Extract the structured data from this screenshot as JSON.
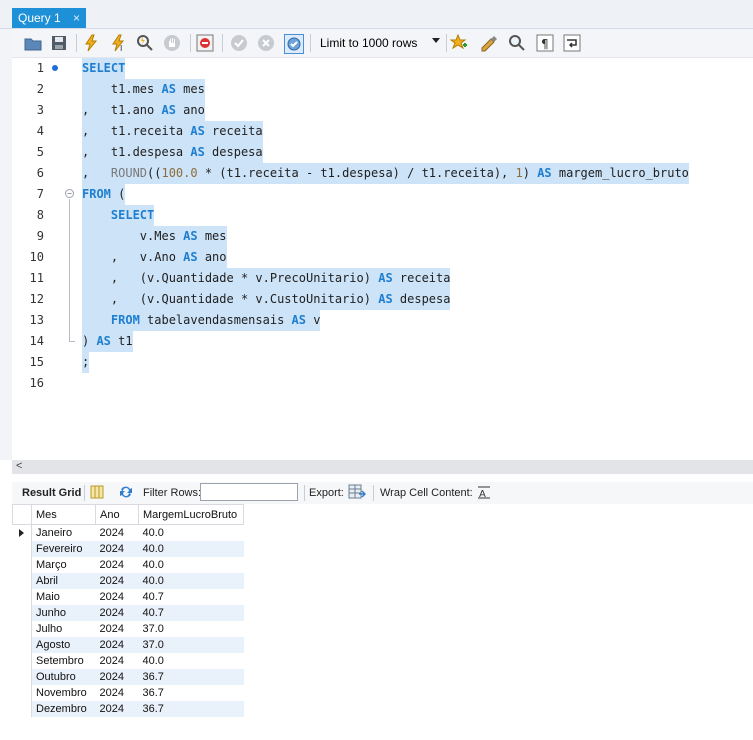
{
  "tab": {
    "title": "Query 1",
    "close": "×"
  },
  "toolbar": {
    "limit_label": "Limit to 1000 rows",
    "icons": [
      "open-file-icon",
      "save-icon",
      "execute-icon",
      "execute-current-icon",
      "explain-icon",
      "stop-icon",
      "toggle-error-icon",
      "commit-icon",
      "rollback-icon",
      "autocommit-icon",
      "limit-select",
      "add-snippet-icon",
      "beautify-icon",
      "find-icon",
      "invisible-chars-icon",
      "wrap-icon"
    ]
  },
  "editor": {
    "lines": [
      {
        "n": "1"
      },
      {
        "n": "2"
      },
      {
        "n": "3"
      },
      {
        "n": "4"
      },
      {
        "n": "5"
      },
      {
        "n": "6"
      },
      {
        "n": "7"
      },
      {
        "n": "8"
      },
      {
        "n": "9"
      },
      {
        "n": "10"
      },
      {
        "n": "11"
      },
      {
        "n": "12"
      },
      {
        "n": "13"
      },
      {
        "n": "14"
      },
      {
        "n": "15"
      },
      {
        "n": "16"
      }
    ],
    "code": {
      "l1_kw": "SELECT",
      "l2_a": "    t1.mes ",
      "l2_kw": "AS",
      "l2_b": " mes",
      "l3_a": ",   t1.ano ",
      "l3_kw": "AS",
      "l3_b": " ano",
      "l4_a": ",   t1.receita ",
      "l4_kw": "AS",
      "l4_b": " receita",
      "l5_a": ",   t1.despesa ",
      "l5_kw": "AS",
      "l5_b": " despesa",
      "l6_a": ",   ",
      "l6_fn": "ROUND",
      "l6_b": "((",
      "l6_n1": "100.0",
      "l6_c": " * (t1.receita - t1.despesa) / t1.receita), ",
      "l6_n2": "1",
      "l6_d": ") ",
      "l6_kw": "AS",
      "l6_e": " margem_lucro_bruto",
      "l7_kw": "FROM",
      "l7_a": " (",
      "l8_a": "    ",
      "l8_kw": "SELECT",
      "l9_a": "        v.Mes ",
      "l9_kw": "AS",
      "l9_b": " mes",
      "l10_a": "    ,   v.Ano ",
      "l10_kw": "AS",
      "l10_b": " ano",
      "l11_a": "    ,   (v.Quantidade * v.PrecoUnitario) ",
      "l11_kw": "AS",
      "l11_b": " receita",
      "l12_a": "    ,   (v.Quantidade * v.CustoUnitario) ",
      "l12_kw": "AS",
      "l12_b": " despesa",
      "l13_a": "    ",
      "l13_kw": "FROM",
      "l13_b": " tabelavendasmensais ",
      "l13_kw2": "AS",
      "l13_c": " v",
      "l14_a": ") ",
      "l14_kw": "AS",
      "l14_b": " t1",
      "l15_a": ";"
    }
  },
  "results_toolbar": {
    "result_grid": "Result Grid",
    "filter_rows": "Filter Rows:",
    "export": "Export:",
    "wrap_cell": "Wrap Cell Content:"
  },
  "grid": {
    "columns": [
      "Mes",
      "Ano",
      "MargemLucroBruto"
    ],
    "rows": [
      [
        "Janeiro",
        "2024",
        "40.0"
      ],
      [
        "Fevereiro",
        "2024",
        "40.0"
      ],
      [
        "Março",
        "2024",
        "40.0"
      ],
      [
        "Abril",
        "2024",
        "40.0"
      ],
      [
        "Maio",
        "2024",
        "40.7"
      ],
      [
        "Junho",
        "2024",
        "40.7"
      ],
      [
        "Julho",
        "2024",
        "37.0"
      ],
      [
        "Agosto",
        "2024",
        "37.0"
      ],
      [
        "Setembro",
        "2024",
        "40.0"
      ],
      [
        "Outubro",
        "2024",
        "36.7"
      ],
      [
        "Novembro",
        "2024",
        "36.7"
      ],
      [
        "Dezembro",
        "2024",
        "36.7"
      ]
    ]
  }
}
